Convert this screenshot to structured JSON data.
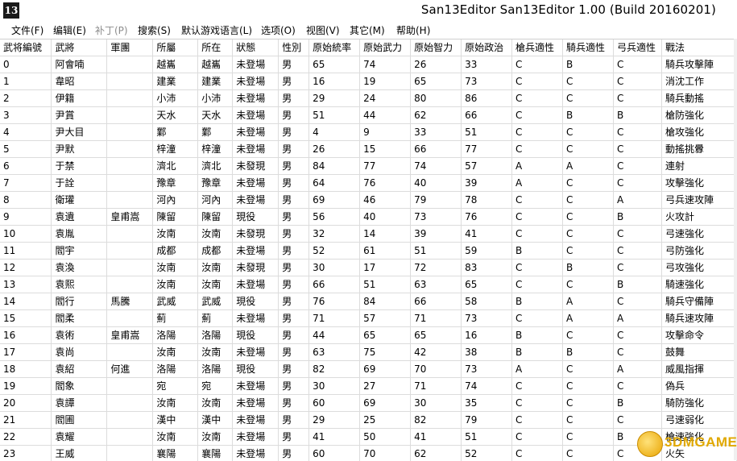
{
  "window": {
    "app_icon_text": "13",
    "title": "San13Editor San13Editor 1.00 (Build 20160201)"
  },
  "menu": [
    {
      "label": "文件(F)",
      "enabled": true
    },
    {
      "label": "编辑(E)",
      "enabled": true
    },
    {
      "label": "补丁(P)",
      "enabled": false
    },
    {
      "label": "搜索(S)",
      "enabled": true
    },
    {
      "label": "默认游戏语言(L)",
      "enabled": true
    },
    {
      "label": "选项(O)",
      "enabled": true
    },
    {
      "label": "视图(V)",
      "enabled": true
    },
    {
      "label": "其它(M)",
      "enabled": true
    },
    {
      "label": "帮助(H)",
      "enabled": true
    }
  ],
  "table": {
    "columns": [
      "武将編號",
      "武將",
      "軍團",
      "所屬",
      "所在",
      "狀態",
      "性別",
      "原始統率",
      "原始武力",
      "原始智力",
      "原始政治",
      "槍兵適性",
      "騎兵適性",
      "弓兵適性",
      "戰法"
    ],
    "rows": [
      [
        "0",
        "阿會喃",
        "",
        "越巂",
        "越巂",
        "未登場",
        "男",
        "65",
        "74",
        "26",
        "33",
        "C",
        "B",
        "C",
        "騎兵攻擊陣"
      ],
      [
        "1",
        "韋昭",
        "",
        "建業",
        "建業",
        "未登場",
        "男",
        "16",
        "19",
        "65",
        "73",
        "C",
        "C",
        "C",
        "消沈工作"
      ],
      [
        "2",
        "伊籍",
        "",
        "小沛",
        "小沛",
        "未登場",
        "男",
        "29",
        "24",
        "80",
        "86",
        "C",
        "C",
        "C",
        "騎兵動搖"
      ],
      [
        "3",
        "尹賞",
        "",
        "天水",
        "天水",
        "未登場",
        "男",
        "51",
        "44",
        "62",
        "66",
        "C",
        "B",
        "B",
        "槍防強化"
      ],
      [
        "4",
        "尹大目",
        "",
        "鄴",
        "鄴",
        "未登場",
        "男",
        "4",
        "9",
        "33",
        "51",
        "C",
        "C",
        "C",
        "槍攻強化"
      ],
      [
        "5",
        "尹默",
        "",
        "梓潼",
        "梓潼",
        "未登場",
        "男",
        "26",
        "15",
        "66",
        "77",
        "C",
        "C",
        "C",
        "動搖挑釁"
      ],
      [
        "6",
        "于禁",
        "",
        "濟北",
        "濟北",
        "未發現",
        "男",
        "84",
        "77",
        "74",
        "57",
        "A",
        "A",
        "C",
        "連射"
      ],
      [
        "7",
        "于詮",
        "",
        "豫章",
        "豫章",
        "未登場",
        "男",
        "64",
        "76",
        "40",
        "39",
        "A",
        "C",
        "C",
        "攻擊強化"
      ],
      [
        "8",
        "衛瓘",
        "",
        "河內",
        "河內",
        "未登場",
        "男",
        "69",
        "46",
        "79",
        "78",
        "C",
        "C",
        "A",
        "弓兵速攻陣"
      ],
      [
        "9",
        "袁遺",
        "皇甫嵩",
        "陳留",
        "陳留",
        "現役",
        "男",
        "56",
        "40",
        "73",
        "76",
        "C",
        "C",
        "B",
        "火攻計"
      ],
      [
        "10",
        "袁胤",
        "",
        "汝南",
        "汝南",
        "未發現",
        "男",
        "32",
        "14",
        "39",
        "41",
        "C",
        "C",
        "C",
        "弓速強化"
      ],
      [
        "11",
        "閻宇",
        "",
        "成都",
        "成都",
        "未登場",
        "男",
        "52",
        "61",
        "51",
        "59",
        "B",
        "C",
        "C",
        "弓防強化"
      ],
      [
        "12",
        "袁渙",
        "",
        "汝南",
        "汝南",
        "未發現",
        "男",
        "30",
        "17",
        "72",
        "83",
        "C",
        "B",
        "C",
        "弓攻強化"
      ],
      [
        "13",
        "袁熙",
        "",
        "汝南",
        "汝南",
        "未登場",
        "男",
        "66",
        "51",
        "63",
        "65",
        "C",
        "C",
        "B",
        "騎速強化"
      ],
      [
        "14",
        "閻行",
        "馬騰",
        "武威",
        "武威",
        "現役",
        "男",
        "76",
        "84",
        "66",
        "58",
        "B",
        "A",
        "C",
        "騎兵守備陣"
      ],
      [
        "15",
        "閻柔",
        "",
        "薊",
        "薊",
        "未登場",
        "男",
        "71",
        "57",
        "71",
        "73",
        "C",
        "A",
        "A",
        "騎兵速攻陣"
      ],
      [
        "16",
        "袁術",
        "皇甫嵩",
        "洛陽",
        "洛陽",
        "現役",
        "男",
        "44",
        "65",
        "65",
        "16",
        "B",
        "C",
        "C",
        "攻擊命令"
      ],
      [
        "17",
        "袁尚",
        "",
        "汝南",
        "汝南",
        "未登場",
        "男",
        "63",
        "75",
        "42",
        "38",
        "B",
        "B",
        "C",
        "鼓舞"
      ],
      [
        "18",
        "袁紹",
        "何進",
        "洛陽",
        "洛陽",
        "現役",
        "男",
        "82",
        "69",
        "70",
        "73",
        "A",
        "C",
        "A",
        "威風指揮"
      ],
      [
        "19",
        "閻象",
        "",
        "宛",
        "宛",
        "未登場",
        "男",
        "30",
        "27",
        "71",
        "74",
        "C",
        "C",
        "C",
        "偽兵"
      ],
      [
        "20",
        "袁譚",
        "",
        "汝南",
        "汝南",
        "未登場",
        "男",
        "60",
        "69",
        "30",
        "35",
        "C",
        "C",
        "B",
        "騎防強化"
      ],
      [
        "21",
        "閻圃",
        "",
        "漢中",
        "漢中",
        "未登場",
        "男",
        "29",
        "25",
        "82",
        "79",
        "C",
        "C",
        "C",
        "弓速弱化"
      ],
      [
        "22",
        "袁耀",
        "",
        "汝南",
        "汝南",
        "未登場",
        "男",
        "41",
        "50",
        "41",
        "51",
        "C",
        "C",
        "B",
        "槍速強化"
      ],
      [
        "23",
        "王威",
        "",
        "襄陽",
        "襄陽",
        "未登場",
        "男",
        "60",
        "70",
        "62",
        "52",
        "C",
        "C",
        "C",
        "火矢"
      ]
    ]
  },
  "watermark": {
    "text": "3DMGAME",
    "color": "#e0a800"
  }
}
